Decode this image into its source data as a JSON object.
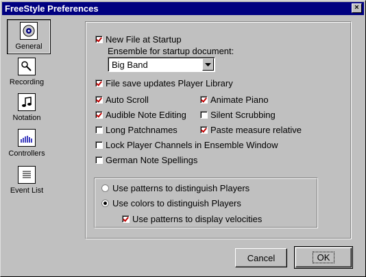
{
  "window": {
    "title": "FreeStyle Preferences",
    "close_glyph": "×"
  },
  "categories": [
    {
      "label": "General",
      "icon": "palette-icon",
      "selected": true
    },
    {
      "label": "Recording",
      "icon": "microphone-icon"
    },
    {
      "label": "Notation",
      "icon": "music-note-icon"
    },
    {
      "label": "Controllers",
      "icon": "controllers-graph-icon"
    },
    {
      "label": "Event List",
      "icon": "event-list-icon"
    }
  ],
  "options": {
    "new_file_at_startup": {
      "label": "New File at Startup",
      "checked": true
    },
    "ensemble_label": "Ensemble for startup document:",
    "ensemble_value": "Big Band",
    "file_save_updates": {
      "label": "File save updates Player Library",
      "checked": true
    },
    "auto_scroll": {
      "label": "Auto Scroll",
      "checked": true
    },
    "animate_piano": {
      "label": "Animate Piano",
      "checked": true
    },
    "audible_note_editing": {
      "label": "Audible Note Editing",
      "checked": true
    },
    "silent_scrubbing": {
      "label": "Silent Scrubbing",
      "checked": false
    },
    "long_patchnames": {
      "label": "Long Patchnames",
      "checked": false
    },
    "paste_measure_relative": {
      "label": "Paste measure relative",
      "checked": true
    },
    "lock_player_channels": {
      "label": "Lock Player Channels in Ensemble Window",
      "checked": false
    },
    "german_note_spellings": {
      "label": "German Note Spellings",
      "checked": false
    }
  },
  "players_group": {
    "patterns_radio": {
      "label": "Use patterns to distinguish Players",
      "checked": false
    },
    "colors_radio": {
      "label": "Use colors to distinguish Players",
      "checked": true
    },
    "velocity_patterns": {
      "label": "Use patterns to display velocities",
      "checked": true
    }
  },
  "buttons": {
    "cancel": "Cancel",
    "ok": "OK"
  }
}
